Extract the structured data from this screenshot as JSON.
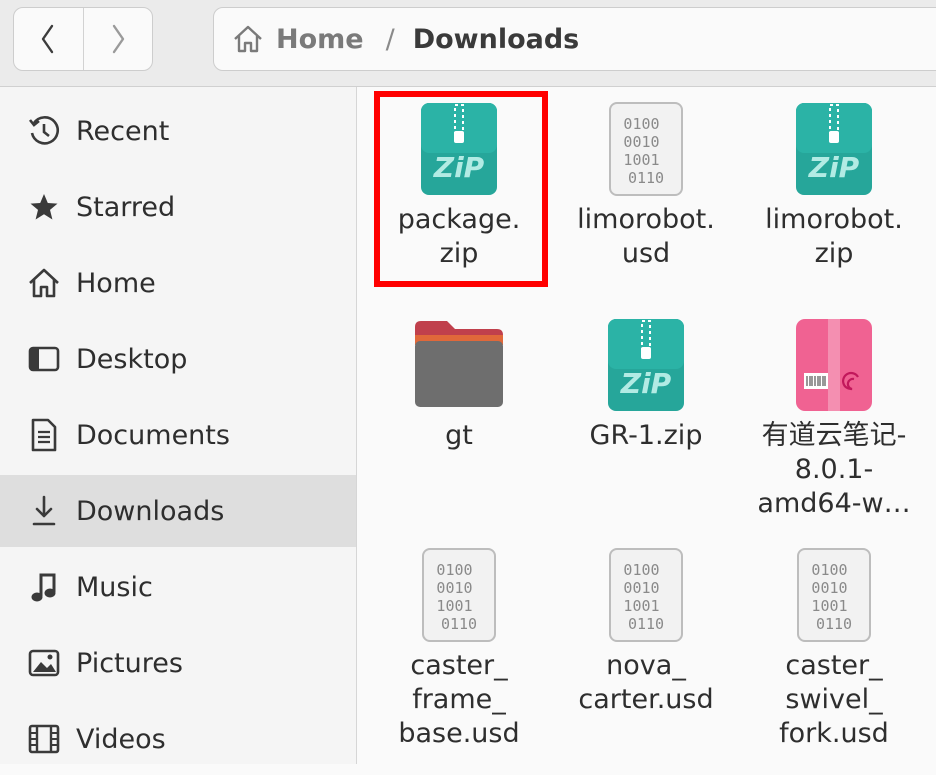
{
  "header": {
    "back_icon": "chevron-left-icon",
    "forward_icon": "chevron-right-icon",
    "breadcrumb": {
      "home": "Home",
      "separator": "/",
      "current": "Downloads"
    }
  },
  "sidebar": {
    "items": [
      {
        "label": "Recent",
        "icon": "clock-icon"
      },
      {
        "label": "Starred",
        "icon": "star-icon"
      },
      {
        "label": "Home",
        "icon": "home-icon"
      },
      {
        "label": "Desktop",
        "icon": "desktop-icon"
      },
      {
        "label": "Documents",
        "icon": "document-icon"
      },
      {
        "label": "Downloads",
        "icon": "download-icon",
        "selected": true
      },
      {
        "label": "Music",
        "icon": "music-icon"
      },
      {
        "label": "Pictures",
        "icon": "picture-icon"
      },
      {
        "label": "Videos",
        "icon": "film-icon"
      }
    ]
  },
  "files": [
    {
      "name": "package.\nzip",
      "type": "zip",
      "highlighted": true
    },
    {
      "name": "limorobot.\nusd",
      "type": "binary"
    },
    {
      "name": "limorobot.\nzip",
      "type": "zip"
    },
    {
      "name": "gt",
      "type": "folder"
    },
    {
      "name": "GR-1.zip",
      "type": "zip"
    },
    {
      "name": "有道云笔记-\n8.0.1-\namd64-w…",
      "type": "deb"
    },
    {
      "name": "caster_\nframe_\nbase.usd",
      "type": "binary"
    },
    {
      "name": "nova_\ncarter.usd",
      "type": "binary"
    },
    {
      "name": "caster_\nswivel_\nfork.usd",
      "type": "binary"
    }
  ],
  "icon_text": {
    "zip_label": "ZiP",
    "binary_lines": [
      "0100",
      "0010",
      "1001",
      "0110"
    ]
  },
  "colors": {
    "zip": "#26a69a",
    "selection_highlight": "#ff0000",
    "deb": "#f06292",
    "folder": "#6e6e6e"
  }
}
